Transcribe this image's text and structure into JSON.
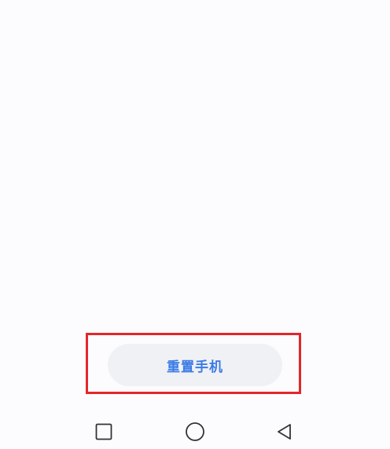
{
  "reset": {
    "button_label": "重置手机"
  },
  "highlight": {
    "color": "#e3262a"
  },
  "navbar": {
    "recent_icon": "square-recent-apps-icon",
    "home_icon": "circle-home-icon",
    "back_icon": "triangle-back-icon"
  },
  "colors": {
    "button_text": "#3b7be6",
    "button_bg": "#f0f1f4",
    "background": "#fcfcfe"
  }
}
